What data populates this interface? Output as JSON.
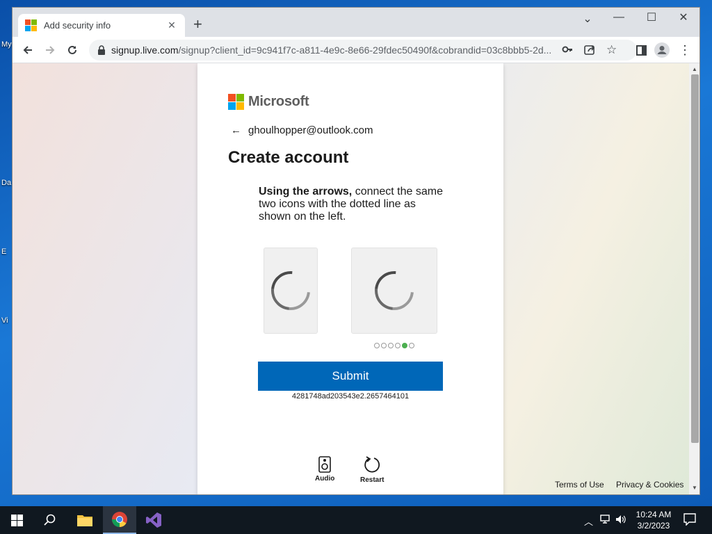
{
  "desktop": {
    "labels": [
      "My",
      "Da",
      "E",
      "Vi"
    ]
  },
  "browser": {
    "tab_title": "Add security info",
    "new_tab_label": "+",
    "url_host": "signup.live.com",
    "url_rest": "/signup?client_id=9c941f7c-a811-4e9c-8e66-29fdec50490f&cobrandid=03c8bbb5-2d..."
  },
  "card": {
    "brand": "Microsoft",
    "identity": "ghoulhopper@outlook.com",
    "heading": "Create account",
    "instruction_bold": "Using the arrows,",
    "instruction_rest": " connect the same two icons with the dotted line as shown on the left.",
    "progress_dots": 6,
    "progress_active_index": 4,
    "submit_label": "Submit",
    "session_id": "4281748ad203543e2.2657464101",
    "audio_label": "Audio",
    "restart_label": "Restart"
  },
  "footer": {
    "terms": "Terms of Use",
    "privacy": "Privacy & Cookies"
  },
  "taskbar": {
    "time": "10:24 AM",
    "date": "3/2/2023"
  },
  "colors": {
    "accent": "#0067b8",
    "progress_active": "#4caf50",
    "ms_red": "#f25022",
    "ms_green": "#7fba00",
    "ms_blue": "#00a4ef",
    "ms_yellow": "#ffb900"
  },
  "icons": [
    "microsoft-logo",
    "back-icon",
    "forward-icon",
    "reload-icon",
    "lock-icon",
    "key-icon",
    "share-icon",
    "star-icon",
    "sidebar-icon",
    "profile-icon",
    "menu-icon",
    "spinner-icon",
    "speaker-icon",
    "restart-icon",
    "windows-icon",
    "search-icon",
    "folder-icon",
    "chrome-icon",
    "visual-studio-icon",
    "network-icon",
    "volume-icon",
    "notification-icon"
  ]
}
